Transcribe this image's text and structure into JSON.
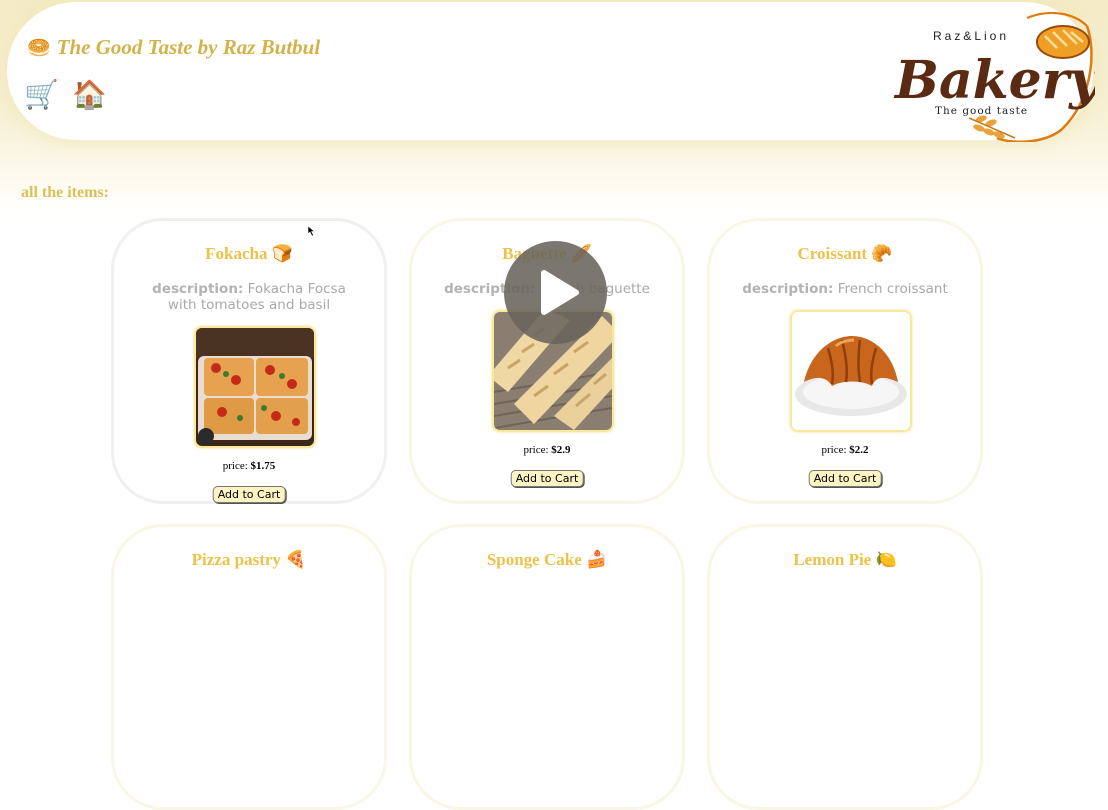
{
  "header": {
    "title": "The Good Taste by Raz Butbul",
    "title_icon": "bagel",
    "nav": [
      {
        "name": "cart-icon",
        "glyph": "🛒"
      },
      {
        "name": "home-icon",
        "glyph": "🏠"
      }
    ],
    "logo": {
      "top_text": "Raz&Lion",
      "main_text": "Bakery",
      "tagline": "The good taste"
    }
  },
  "section_title": "all the items:",
  "products": [
    {
      "name": "Fokacha 🍞",
      "description_label": "description:",
      "description": "Fokacha Focsa with tomatoes and basil",
      "price_label": "price:",
      "price": "$1.75",
      "button": "Add to Cart"
    },
    {
      "name": "Baguette 🥖",
      "description_label": "description:",
      "description": "French baguette",
      "price_label": "price:",
      "price": "$2.9",
      "button": "Add to Cart"
    },
    {
      "name": "Croissant 🥐",
      "description_label": "description:",
      "description": "French croissant",
      "price_label": "price:",
      "price": "$2.2",
      "button": "Add to Cart"
    },
    {
      "name": "Pizza pastry 🍕"
    },
    {
      "name": "Sponge Cake 🍰"
    },
    {
      "name": "Lemon Pie 🍋"
    }
  ],
  "colors": {
    "title": "#d4b24a",
    "card_title": "#ecc24a",
    "header_glow": "#f3ecc6",
    "button_bg": "#fdf3c3"
  }
}
